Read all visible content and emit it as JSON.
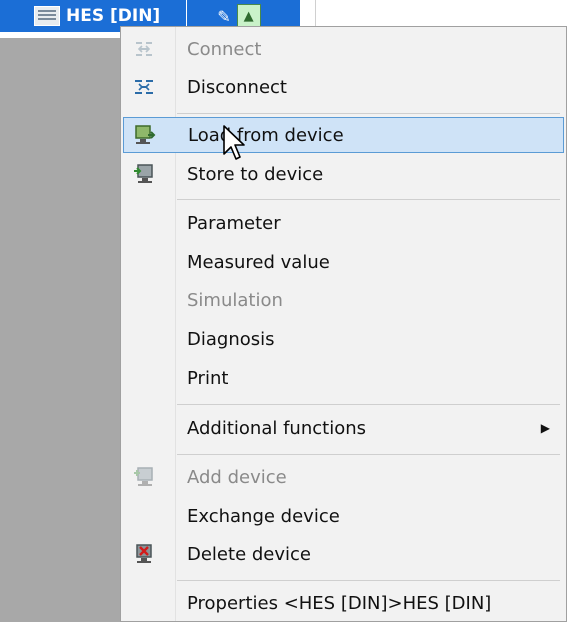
{
  "node": {
    "label": "HES [DIN]"
  },
  "menu": {
    "items": [
      {
        "label": "Connect",
        "icon": "connect-icon",
        "enabled": false
      },
      {
        "label": "Disconnect",
        "icon": "disconnect-icon",
        "enabled": true
      },
      {
        "label": "Load from device",
        "icon": "load-from-device-icon",
        "enabled": true,
        "highlighted": true
      },
      {
        "label": "Store to device",
        "icon": "store-to-device-icon",
        "enabled": true
      },
      {
        "label": "Parameter",
        "enabled": true
      },
      {
        "label": "Measured value",
        "enabled": true
      },
      {
        "label": "Simulation",
        "enabled": false
      },
      {
        "label": "Diagnosis",
        "enabled": true
      },
      {
        "label": "Print",
        "enabled": true
      },
      {
        "label": "Additional functions",
        "enabled": true,
        "submenu": true
      },
      {
        "label": "Add device",
        "icon": "add-device-icon",
        "enabled": false
      },
      {
        "label": "Exchange device",
        "enabled": true
      },
      {
        "label": "Delete device",
        "icon": "delete-device-icon",
        "enabled": true
      },
      {
        "label": "Properties <HES [DIN]>HES [DIN]",
        "enabled": true
      }
    ]
  },
  "colors": {
    "selection_blue": "#1b6ed6",
    "hover_bg": "#cfe3f7",
    "hover_border": "#5b9bd5",
    "disabled_text": "#8a8a8a"
  }
}
